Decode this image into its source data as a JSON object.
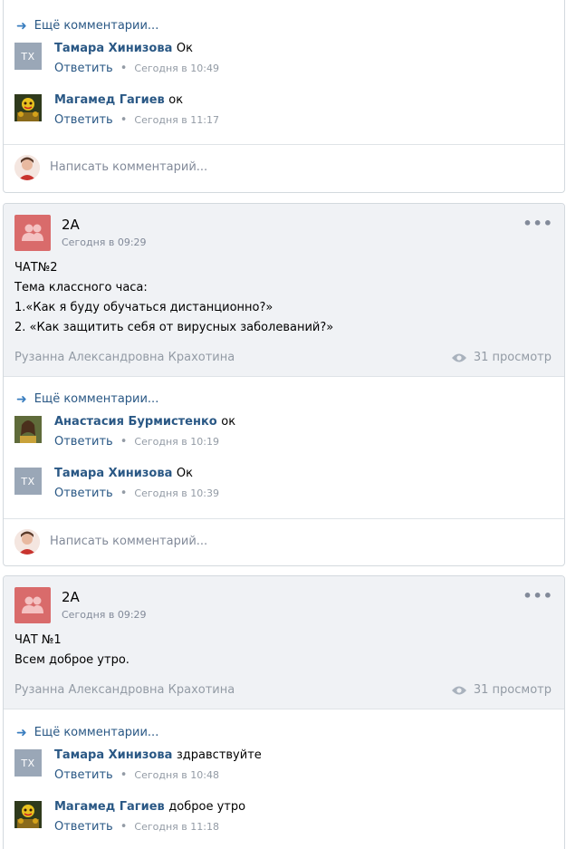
{
  "card1": {
    "more_comments": "Ещё комментарии...",
    "comments": [
      {
        "avatar_text": "ТХ",
        "author": "Тамара Хинизова",
        "text": "Ок",
        "reply": "Ответить",
        "time": "Сегодня в 10:49"
      },
      {
        "avatar_text": "",
        "author": "Магамед Гагиев",
        "text": "ок",
        "reply": "Ответить",
        "time": "Сегодня в 11:17"
      }
    ],
    "write_placeholder": "Написать комментарий..."
  },
  "card2": {
    "group_name": "2А",
    "post_time": "Сегодня в 09:29",
    "more": "•••",
    "lines": [
      "ЧАТ№2",
      "Тема классного часа:",
      "1.«Как я буду обучаться дистанционно?»",
      "2. «Как защитить себя от вирусных заболеваний?»"
    ],
    "author": "Рузанна Александровна Крахотина",
    "views": "31 просмотр",
    "more_comments": "Ещё комментарии...",
    "comments": [
      {
        "avatar_text": "",
        "author": "Анастасия Бурмистенко",
        "text": "ок",
        "reply": "Ответить",
        "time": "Сегодня в 10:19"
      },
      {
        "avatar_text": "ТХ",
        "author": "Тамара Хинизова",
        "text": "Ок",
        "reply": "Ответить",
        "time": "Сегодня в 10:39"
      }
    ],
    "write_placeholder": "Написать комментарий..."
  },
  "card3": {
    "group_name": "2А",
    "post_time": "Сегодня в 09:29",
    "more": "•••",
    "lines": [
      "ЧАТ №1",
      "Всем доброе утро."
    ],
    "author": "Рузанна Александровна Крахотина",
    "views": "31 просмотр",
    "more_comments": "Ещё комментарии...",
    "comments": [
      {
        "avatar_text": "ТХ",
        "author": "Тамара Хинизова",
        "text": "здравствуйте",
        "reply": "Ответить",
        "time": "Сегодня в 10:48"
      },
      {
        "avatar_text": "",
        "author": "Магамед Гагиев",
        "text": "доброе утро",
        "reply": "Ответить",
        "time": "Сегодня в 11:18"
      }
    ]
  },
  "icons": {
    "arrow": "arrow-right-icon",
    "eye": "eye-icon",
    "group": "group-icon",
    "more": "more-dots-icon"
  },
  "colors": {
    "link": "#2a5885",
    "accent": "#3a7ebf",
    "group_avatar": "#d96b6b",
    "muted": "#939ba5"
  }
}
